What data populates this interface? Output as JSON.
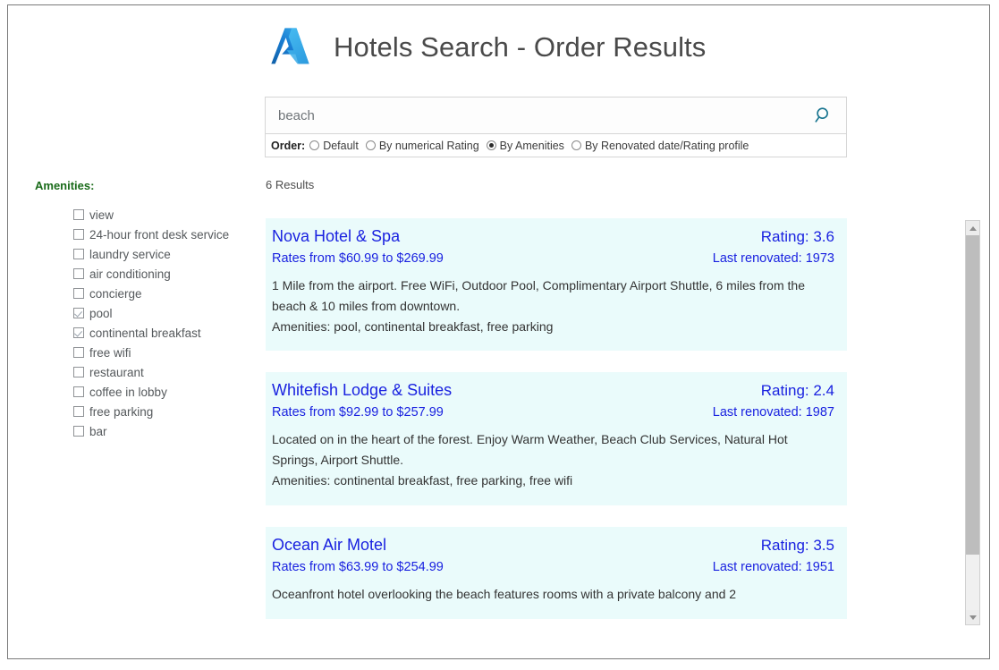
{
  "header": {
    "title": "Hotels Search - Order Results",
    "logo_icon": "azure-logo-icon"
  },
  "search": {
    "value": "beach",
    "placeholder": "",
    "search_icon": "search-icon",
    "order_label": "Order:",
    "order_options": [
      {
        "label": "Default",
        "selected": false
      },
      {
        "label": "By numerical Rating",
        "selected": false
      },
      {
        "label": "By Amenities",
        "selected": true
      },
      {
        "label": "By Renovated date/Rating profile",
        "selected": false
      }
    ]
  },
  "sidebar": {
    "title": "Amenities:",
    "title_color": "#1a6b1a",
    "items": [
      {
        "label": "view",
        "checked": false
      },
      {
        "label": "24-hour front desk service",
        "checked": false
      },
      {
        "label": "laundry service",
        "checked": false
      },
      {
        "label": "air conditioning",
        "checked": false
      },
      {
        "label": "concierge",
        "checked": false
      },
      {
        "label": "pool",
        "checked": true
      },
      {
        "label": "continental breakfast",
        "checked": true
      },
      {
        "label": "free wifi",
        "checked": false
      },
      {
        "label": "restaurant",
        "checked": false
      },
      {
        "label": "coffee in lobby",
        "checked": false
      },
      {
        "label": "free parking",
        "checked": false
      },
      {
        "label": "bar",
        "checked": false
      }
    ]
  },
  "results": {
    "count_text": "6 Results",
    "link_color": "#1a22e0",
    "card_background": "#eafbfb",
    "cards": [
      {
        "name": "Nova Hotel & Spa",
        "rating": "Rating: 3.6",
        "rates": "Rates from $60.99 to $269.99",
        "renovated": "Last renovated: 1973",
        "description": "1 Mile from the airport.  Free WiFi, Outdoor Pool, Complimentary Airport Shuttle, 6 miles from the beach & 10 miles from downtown.",
        "amenities": "Amenities: pool, continental breakfast, free parking"
      },
      {
        "name": "Whitefish Lodge & Suites",
        "rating": "Rating: 2.4",
        "rates": "Rates from $92.99 to $257.99",
        "renovated": "Last renovated: 1987",
        "description": "Located on in the heart of the forest. Enjoy Warm Weather, Beach Club Services, Natural Hot Springs, Airport Shuttle.",
        "amenities": "Amenities: continental breakfast, free parking, free wifi"
      },
      {
        "name": "Ocean Air Motel",
        "rating": "Rating: 3.5",
        "rates": "Rates from $63.99 to $254.99",
        "renovated": "Last renovated: 1951",
        "description": "Oceanfront hotel overlooking the beach features rooms with a private balcony and 2",
        "amenities": ""
      }
    ]
  },
  "scrollbar": {
    "up_icon": "chevron-up-icon",
    "down_icon": "chevron-down-icon",
    "thumb": "scrollbar-thumb"
  }
}
